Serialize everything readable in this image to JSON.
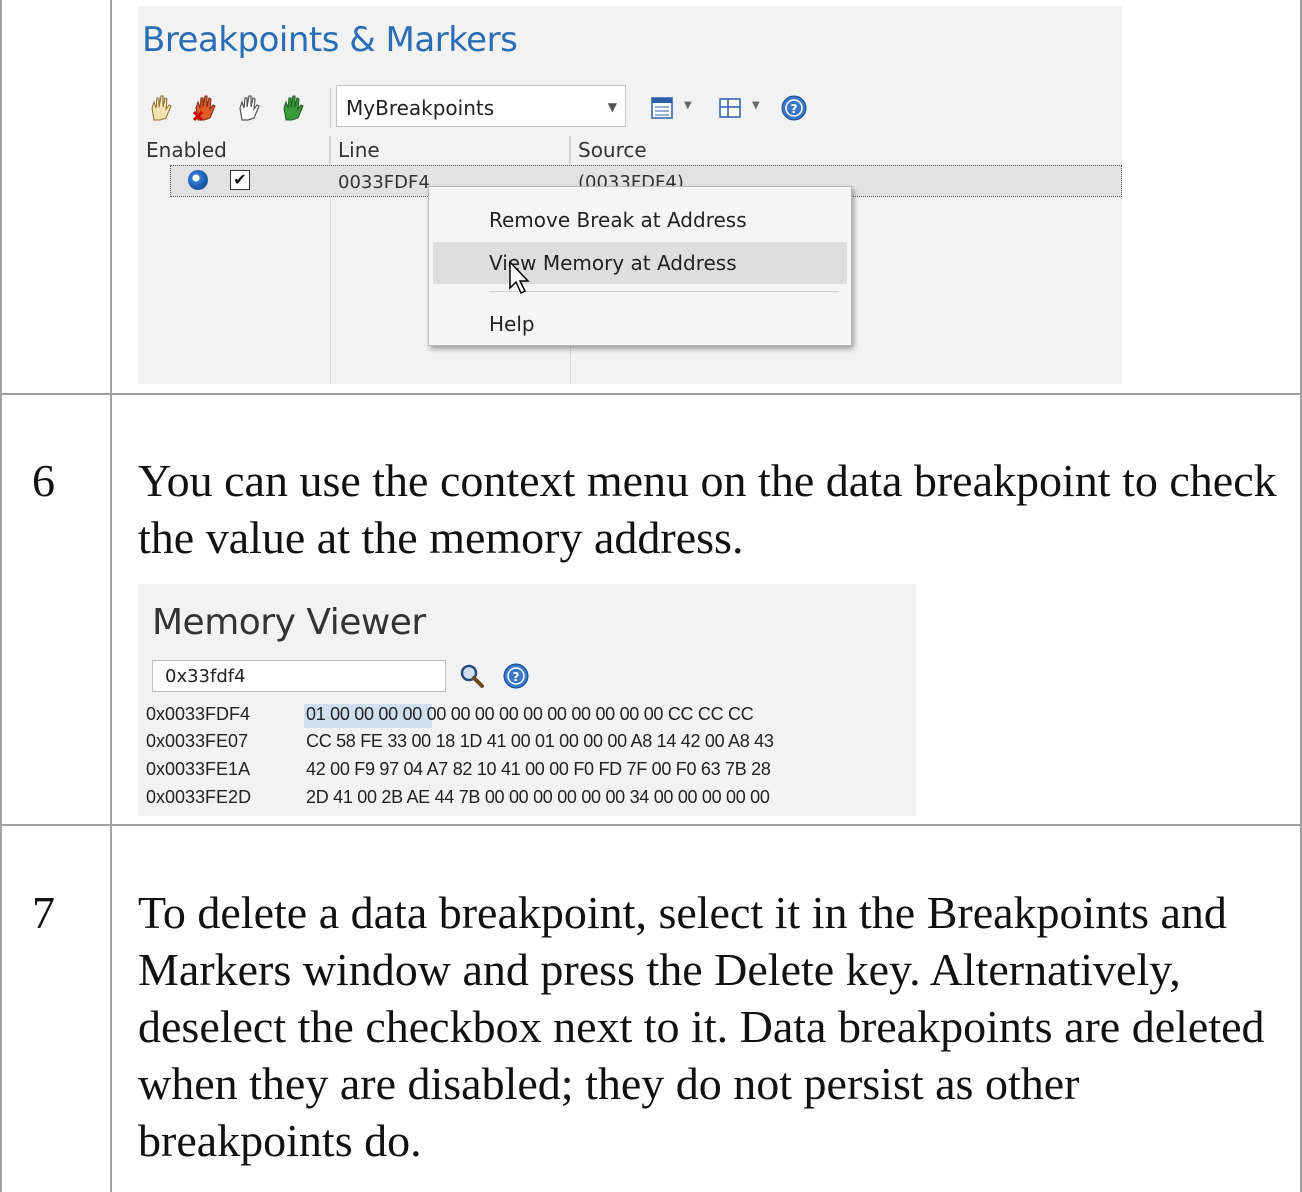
{
  "breakpoints_window": {
    "title": "Breakpoints & Markers",
    "toolbar": {
      "icons": [
        "enable-breakpoint-icon",
        "delete-breakpoint-icon",
        "disable-breakpoint-icon",
        "enable-all-icon",
        "list-view-icon",
        "layout-icon",
        "help-icon"
      ],
      "set_selector": "MyBreakpoints"
    },
    "columns": [
      "Enabled",
      "Line",
      "Source"
    ],
    "rows": [
      {
        "enabled": true,
        "line": "0033FDF4",
        "source": "(0033FDF4)"
      }
    ],
    "context_menu": {
      "items": [
        "Remove Break at Address",
        "View Memory at Address",
        "Help"
      ],
      "highlighted": "View Memory at Address"
    }
  },
  "steps": [
    {
      "number": "6",
      "text": "You can use the context menu on the data breakpoint to check the value at the memory address."
    },
    {
      "number": "7",
      "text": "To delete a data breakpoint, select it in the Breakpoints and Markers window and press the Delete key. Alternatively, deselect the checkbox next to it. Data breakpoints are deleted when they are disabled; they do not persist as other breakpoints do."
    }
  ],
  "memory_viewer": {
    "title": "Memory Viewer",
    "address_input": "0x33fdf4",
    "rows": [
      {
        "address": "0x0033FDF4",
        "bytes": "01 00 00 00 00 00 00 00 00 00 00 00 00 00 00 CC CC CC"
      },
      {
        "address": "0x0033FE07",
        "bytes": "CC 58 FE 33 00 18 1D 41 00 01 00 00 00 A8 14 42 00 A8 43"
      },
      {
        "address": "0x0033FE1A",
        "bytes": "42 00 F9 97 04 A7 82 10 41 00 00 F0 FD 7F 00 F0 63 7B 28"
      },
      {
        "address": "0x0033FE2D",
        "bytes": "2D 41 00 2B AE 44 7B 00 00 00 00 00 00 34 00 00 00 00 00"
      }
    ]
  }
}
